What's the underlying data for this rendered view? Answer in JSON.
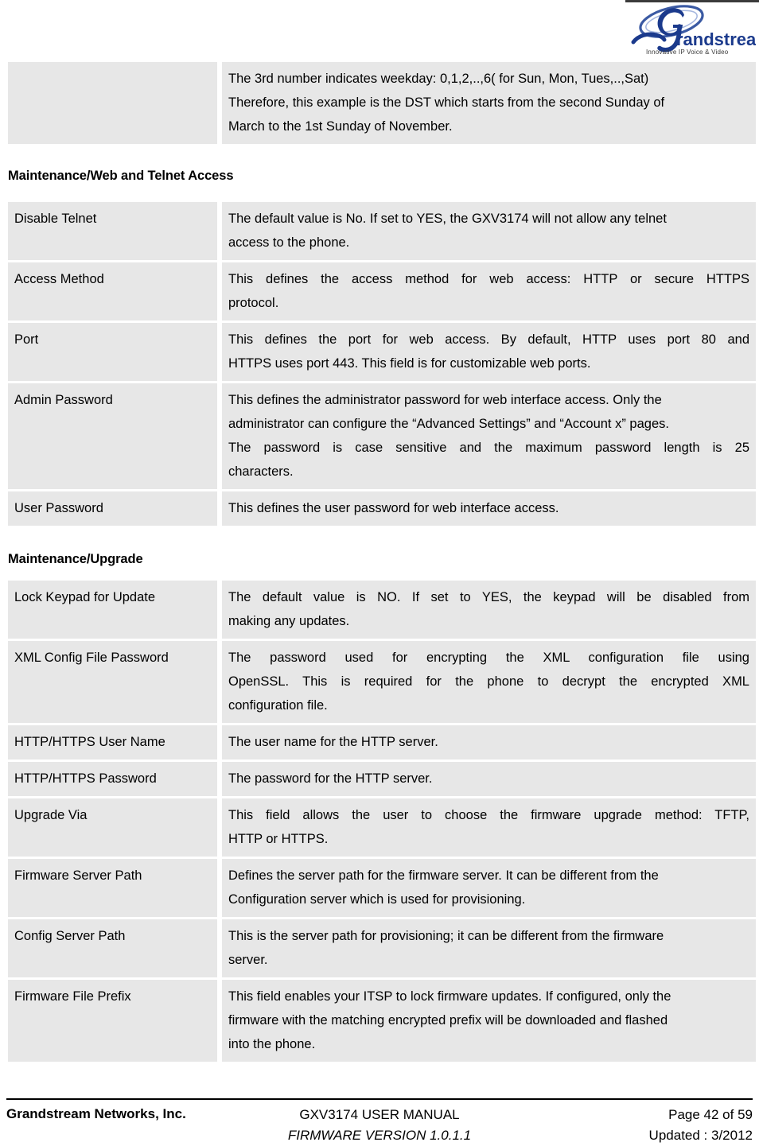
{
  "header": {
    "logo_name": "grandstream-logo",
    "logo_wordmark": "randstream",
    "logo_tagline": "Innovative IP Voice & Video",
    "logo_color": "#1b3a8c"
  },
  "continued_table": {
    "rows": [
      {
        "label": "",
        "align": "left",
        "lines": [
          "The 3rd number indicates weekday: 0,1,2,..,6( for Sun, Mon, Tues,..,Sat)",
          "Therefore, this example is the DST which starts from the second Sunday of",
          "March to the 1st Sunday of November."
        ]
      }
    ]
  },
  "sections": [
    {
      "heading": "Maintenance/Web and Telnet Access",
      "rows": [
        {
          "label": "Disable Telnet",
          "align": "left",
          "lines": [
            "The default value is No. If set to YES, the GXV3174 will not allow any telnet",
            "access to the phone."
          ]
        },
        {
          "label": "Access Method",
          "align": "justify",
          "lines": [
            "This defines the access method for web access: HTTP or secure HTTPS",
            "protocol."
          ]
        },
        {
          "label": "Port",
          "align": "justify",
          "lines": [
            "This defines the port for web access. By default, HTTP uses port 80 and",
            "HTTPS uses port 443. This field is for customizable web ports."
          ]
        },
        {
          "label": "Admin Password",
          "align": "justify",
          "lines": [
            "This defines the administrator password for web interface access. Only the",
            "administrator can configure the “Advanced Settings” and “Account x” pages.",
            "The password is case sensitive and the maximum password length is 25",
            "characters."
          ]
        },
        {
          "label": "User Password",
          "align": "left",
          "lines": [
            "This defines the user password for web interface access."
          ]
        }
      ]
    },
    {
      "heading": "Maintenance/Upgrade",
      "rows": [
        {
          "label": "Lock Keypad for Update",
          "align": "justify",
          "lines": [
            "The default value is NO. If set to YES, the keypad will be disabled from",
            "making any updates."
          ]
        },
        {
          "label": "XML Config File Password",
          "align": "justify",
          "lines": [
            "The password used for encrypting the XML configuration file using",
            "OpenSSL. This is required for the phone to decrypt the encrypted XML",
            "configuration file."
          ]
        },
        {
          "label": "HTTP/HTTPS User Name",
          "align": "left",
          "lines": [
            "The user name for the HTTP server."
          ]
        },
        {
          "label": "HTTP/HTTPS Password",
          "align": "left",
          "lines": [
            "The password for the HTTP server."
          ]
        },
        {
          "label": "Upgrade Via",
          "align": "justify",
          "lines": [
            "This field allows the user to choose the firmware upgrade method: TFTP,",
            "HTTP or HTTPS."
          ]
        },
        {
          "label": "Firmware Server Path",
          "align": "left",
          "lines": [
            "Defines the server path for the firmware server. It can be different from the",
            "Configuration server which is used for provisioning."
          ]
        },
        {
          "label": "Config Server Path",
          "align": "left",
          "lines": [
            "This is the server path for provisioning; it can be different from the firmware",
            "server."
          ]
        },
        {
          "label": "Firmware File Prefix",
          "align": "left",
          "lines": [
            "This field enables your ITSP to lock firmware updates. If configured, only the",
            "firmware with the matching encrypted prefix will be downloaded and flashed",
            "into the phone."
          ]
        }
      ]
    }
  ],
  "footer": {
    "company": "Grandstream Networks, Inc.",
    "manual_title": "GXV3174 USER MANUAL",
    "firmware_version": "FIRMWARE VERSION 1.0.1.1",
    "page_number": "Page 42 of 59",
    "updated": "Updated : 3/2012"
  }
}
